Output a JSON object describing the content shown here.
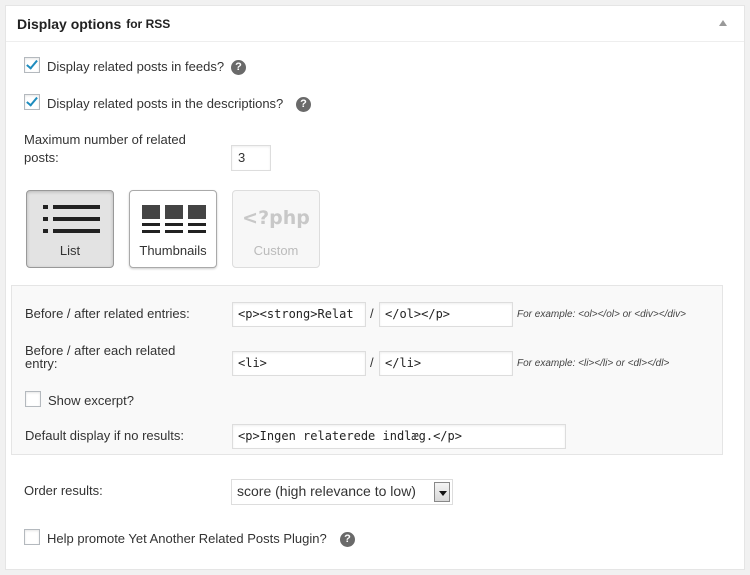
{
  "header": {
    "title": "Display options",
    "suffix": "for RSS"
  },
  "options": {
    "feeds_label": "Display related posts in feeds?",
    "descriptions_label": "Display related posts in the descriptions?",
    "help_glyph": "?",
    "max_label_line1": "Maximum number of related",
    "max_label_line2": "posts:",
    "max_value": "3"
  },
  "templates": [
    {
      "label": "List",
      "icon": "list-icon",
      "state": "selected"
    },
    {
      "label": "Thumbnails",
      "icon": "thumbnails-icon",
      "state": "normal"
    },
    {
      "label": "Custom",
      "icon": "php-icon",
      "icon_text": "<?php",
      "state": "disabled"
    }
  ],
  "advanced": {
    "before_after_label": "Before / after related entries:",
    "before_value": "<p><strong>Relat",
    "after_value": "</ol></p>",
    "before_after_example": "For example: <ol></ol> or <div></div>",
    "each_label_line1": "Before / after each related",
    "each_label_line2": "entry:",
    "each_before_value": "<li>",
    "each_after_value": "</li>",
    "each_example": "For example: <li></li> or <dl></dl>",
    "slash": "/",
    "excerpt_label": "Show excerpt?",
    "no_results_label": "Default display if no results:",
    "no_results_value": "<p>Ingen relaterede indlæg.</p>"
  },
  "order": {
    "label": "Order results:",
    "selected": "score (high relevance to low)"
  },
  "promote": {
    "label": "Help promote Yet Another Related Posts Plugin?"
  },
  "colors": {
    "accent_check": "#1e8cbe",
    "panel_bg": "#ffffff",
    "page_bg": "#f1f1f1"
  }
}
